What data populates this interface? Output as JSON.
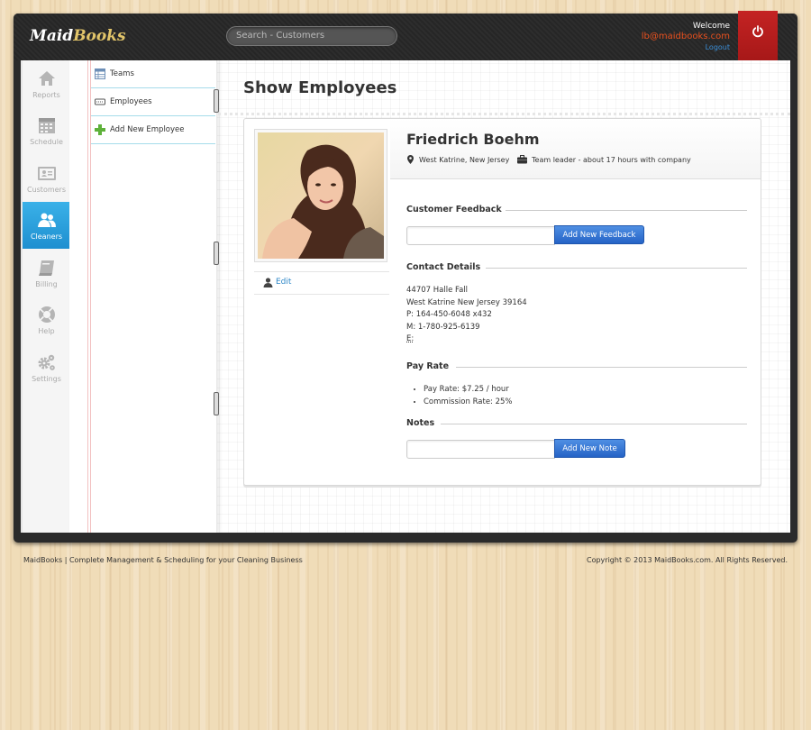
{
  "app": {
    "logo_maid": "Maid",
    "logo_books": "Books"
  },
  "search": {
    "placeholder": "Search - Customers"
  },
  "user": {
    "welcome": "Welcome",
    "email": "lb@maidbooks.com",
    "logout": "Logout"
  },
  "sidebar": {
    "items": [
      {
        "label": "Reports",
        "icon": "home-icon",
        "active": false
      },
      {
        "label": "Schedule",
        "icon": "calendar-icon",
        "active": false
      },
      {
        "label": "Customers",
        "icon": "contact-card-icon",
        "active": false
      },
      {
        "label": "Cleaners",
        "icon": "users-icon",
        "active": true
      },
      {
        "label": "Billing",
        "icon": "book-icon",
        "active": false
      },
      {
        "label": "Help",
        "icon": "lifebuoy-icon",
        "active": false
      },
      {
        "label": "Settings",
        "icon": "gears-icon",
        "active": false
      }
    ]
  },
  "submenu": {
    "items": [
      {
        "label": "Teams",
        "icon": "table-icon"
      },
      {
        "label": "Employees",
        "icon": "id-card-icon"
      },
      {
        "label": "Add New Employee",
        "icon": "plus-icon"
      }
    ]
  },
  "page": {
    "title": "Show Employees"
  },
  "employee": {
    "name": "Friedrich Boehm",
    "location": "West Katrine, New Jersey",
    "role": "Team leader - about 17 hours with company",
    "edit_label": "Edit",
    "photo_icon": "employee-photo"
  },
  "feedback": {
    "heading": "Customer Feedback",
    "button": "Add New Feedback"
  },
  "contact": {
    "heading": "Contact Details",
    "line1": "44707 Halle Fall",
    "line2": "West Katrine New Jersey 39164",
    "phone": "P: 164-450-6048 x432",
    "mobile": "M: 1-780-925-6139",
    "email": "E:"
  },
  "pay": {
    "heading": "Pay Rate",
    "rate": "Pay Rate: $7.25 / hour",
    "commission": "Commission Rate: 25%"
  },
  "notes": {
    "heading": "Notes",
    "button": "Add New Note"
  },
  "footer": {
    "left": "MaidBooks | Complete Management & Scheduling for your Cleaning Business",
    "right": "Copyright © 2013 MaidBooks.com. All Rights Reserved."
  },
  "colors": {
    "accent": "#2f7fd6",
    "active_nav": "#2b9fe0",
    "ribbon": "#b71c1c",
    "email": "#e8501e"
  }
}
